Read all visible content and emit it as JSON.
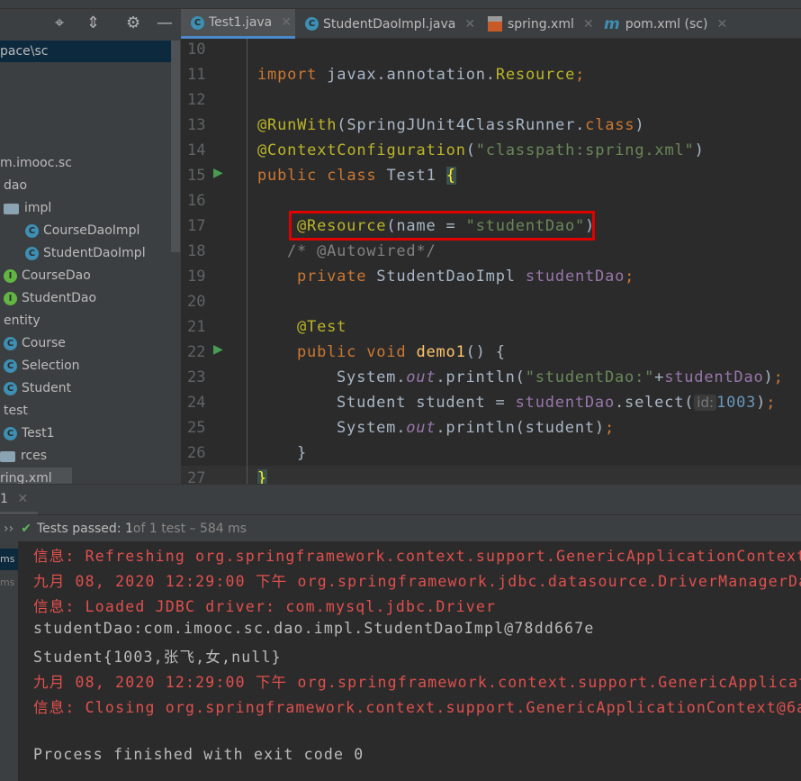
{
  "sidebar": {
    "path": "pace\\sc",
    "tree": [
      {
        "label": "m.imooc.sc",
        "type": "package"
      },
      {
        "label": "dao",
        "type": "package"
      },
      {
        "label": "impl",
        "type": "folder"
      },
      {
        "label": "CourseDaoImpl",
        "type": "class"
      },
      {
        "label": "StudentDaoImpl",
        "type": "class"
      },
      {
        "label": "CourseDao",
        "type": "interface"
      },
      {
        "label": "StudentDao",
        "type": "interface"
      },
      {
        "label": "entity",
        "type": "package"
      },
      {
        "label": "Course",
        "type": "class"
      },
      {
        "label": "Selection",
        "type": "class"
      },
      {
        "label": "Student",
        "type": "class"
      },
      {
        "label": "test",
        "type": "package"
      },
      {
        "label": "Test1",
        "type": "class"
      },
      {
        "label": "rces",
        "type": "folder"
      },
      {
        "label": "ring.xml",
        "type": "file"
      }
    ]
  },
  "tabs": [
    {
      "label": "Test1.java",
      "icon": "java-class-icon",
      "active": true
    },
    {
      "label": "StudentDaoImpl.java",
      "icon": "java-class-icon"
    },
    {
      "label": "spring.xml",
      "icon": "spring-xml-icon"
    },
    {
      "label": "pom.xml (sc)",
      "icon": "maven-icon"
    }
  ],
  "editor": {
    "line_numbers": [
      "10",
      "11",
      "12",
      "13",
      "14",
      "15",
      "16",
      "17",
      "18",
      "19",
      "20",
      "21",
      "22",
      "23",
      "24",
      "25",
      "26",
      "27"
    ],
    "hint_label": "id:",
    "code": {
      "l11a": "import",
      "l11b": " javax.annotation.",
      "l11c": "Resource",
      "l11d": ";",
      "l13a": "@RunWith",
      "l13b": "(SpringJUnit4ClassRunner.",
      "l13c": "class",
      "l13d": ")",
      "l14a": "@ContextConfiguration",
      "l14b": "(",
      "l14c": "\"classpath:spring.xml\"",
      "l14d": ")",
      "l15a": "public class",
      "l15b": " Test1 ",
      "l15c": "{",
      "l17a": "@Resource",
      "l17b": "(name = ",
      "l17c": "\"studentDao\"",
      "l17d": ")",
      "l18": "/* @Autowired*/",
      "l19a": "private",
      "l19b": " StudentDaoImpl ",
      "l19c": "studentDao",
      "l19d": ";",
      "l21": "@Test",
      "l22a": "public void",
      "l22b": "demo1",
      "l22c": "() {",
      "l23a": "System.",
      "l23b": "out",
      "l23c": ".println(",
      "l23d": "\"studentDao:\"",
      "l23e": "+",
      "l23f": "studentDao",
      "l23g": ")",
      "l23h": ";",
      "l24a": "Student student = ",
      "l24b": "studentDao",
      "l24c": ".select(",
      "l24d": "1003",
      "l24e": ")",
      "l24f": ";",
      "l25a": "System.",
      "l25b": "out",
      "l25c": ".println(student)",
      "l25d": ";",
      "l26": "}",
      "l27": "}"
    }
  },
  "run_panel": {
    "tab_label": "1",
    "status_prefix": "Tests passed: 1",
    "status_suffix": " of 1 test – 584 ms",
    "side_items": [
      "ms",
      "ms"
    ],
    "console": [
      {
        "text": "信息: Refreshing org.springframework.context.support.GenericApplicationContext@",
        "type": "err"
      },
      {
        "text": "九月 08, 2020 12:29:00 下午 org.springframework.jdbc.datasource.DriverManagerDa",
        "type": "err"
      },
      {
        "text": "信息: Loaded JDBC driver: com.mysql.jdbc.Driver",
        "type": "err"
      },
      {
        "text": "studentDao:com.imooc.sc.dao.impl.StudentDaoImpl@78dd667e",
        "type": "out"
      },
      {
        "text": "Student{1003,张飞,女,null}",
        "type": "out"
      },
      {
        "text": "九月 08, 2020 12:29:00 下午 org.springframework.context.support.GenericApplicat",
        "type": "err"
      },
      {
        "text": "信息: Closing org.springframework.context.support.GenericApplicationContext@6a",
        "type": "err"
      },
      {
        "text": "",
        "type": "out"
      },
      {
        "text": "Process finished with exit code 0",
        "type": "out"
      }
    ]
  },
  "colors": {
    "accent": "#4a88c7",
    "keyword": "#cc7832",
    "annotation": "#bbb529",
    "string": "#6a8759",
    "field": "#9876aa",
    "error": "#e0504e",
    "highlight_box": "#e00000"
  }
}
